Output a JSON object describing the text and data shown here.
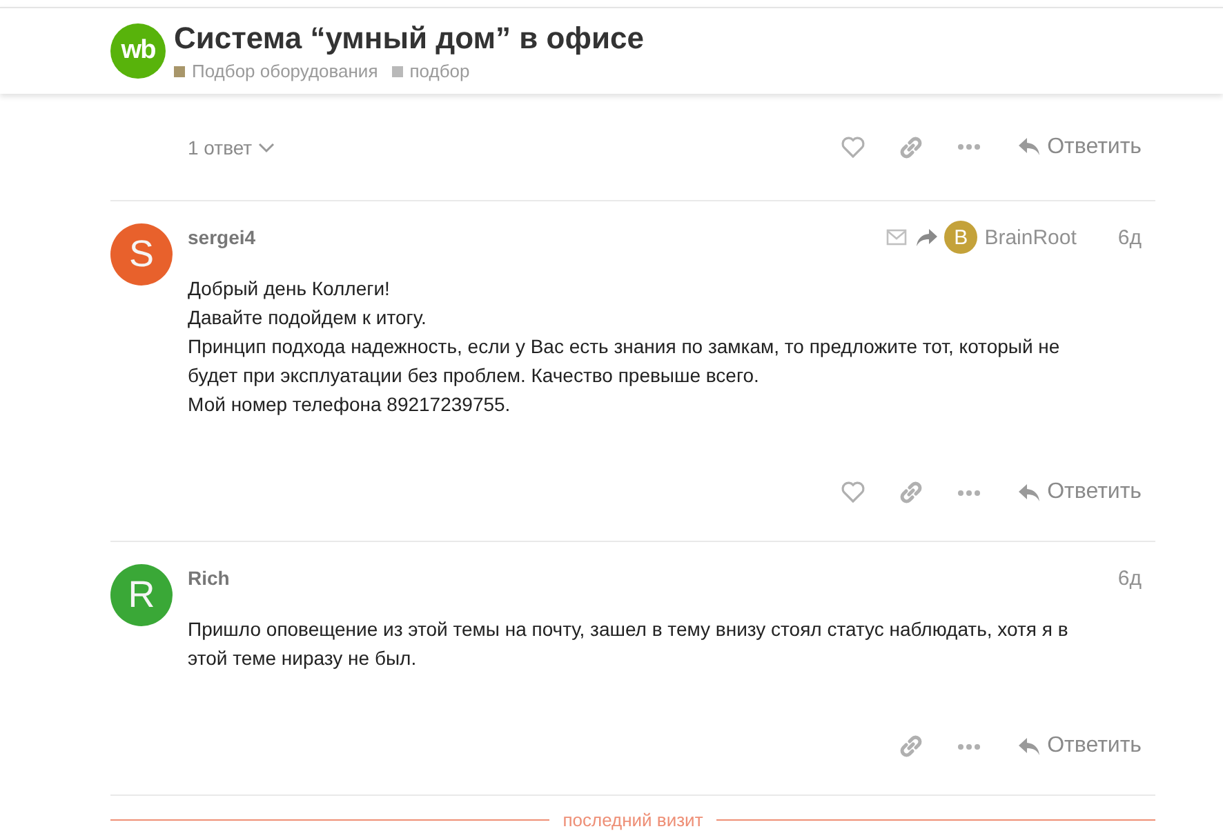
{
  "topic": {
    "logo": "wb",
    "title": "Система “умный дом” в офисе",
    "categories": [
      {
        "name": "Подбор оборудования",
        "color": "#a8966a"
      },
      {
        "name": "подбор",
        "color": "#b9b9b9"
      }
    ]
  },
  "posts": [
    {
      "kind": "tail",
      "replies": "1 ответ",
      "can_like": true,
      "reply_label": "Ответить"
    },
    {
      "kind": "full",
      "author": "sergei4",
      "avatar": {
        "letter": "S",
        "color": "#e8612c"
      },
      "via_email": true,
      "reply_to": {
        "letter": "B",
        "color": "#c4a23a",
        "name": "BrainRoot"
      },
      "age": "6д",
      "body": "Добрый день Коллеги!\nДавайте подойдем к итогу.\nПринцип подхода надежность, если у Вас есть знания по замкам, то предложите тот, который не будет при эксплуатации без проблем. Качество превыше всего.\nМой номер телефона 89217239755.",
      "can_like": true,
      "reply_label": "Ответить"
    },
    {
      "kind": "full",
      "author": "Rich",
      "avatar": {
        "letter": "R",
        "color": "#3aa837"
      },
      "via_email": false,
      "age": "6д",
      "body": "Пришло оповещение из этой темы на почту, зашел в тему внизу стоял статус наблюдать, хотя я в этой теме ниразу не был.",
      "can_like": false,
      "reply_label": "Ответить"
    }
  ],
  "last_visit": "последний визит"
}
